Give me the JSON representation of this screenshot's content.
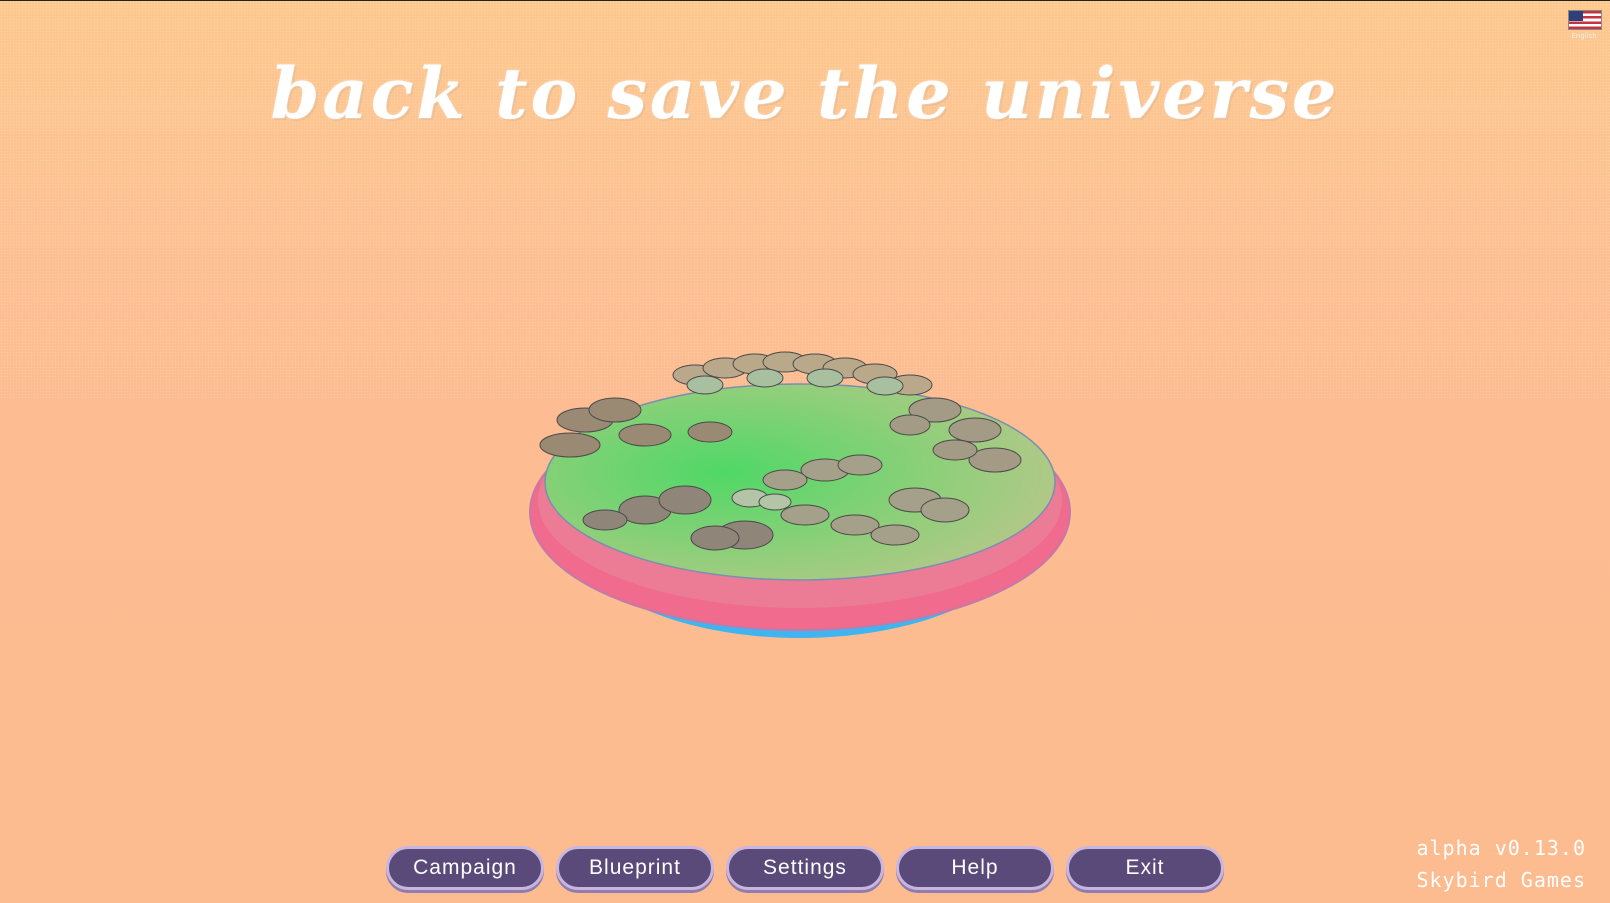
{
  "title": "back to save the universe",
  "language": {
    "icon": "us-flag-icon",
    "label": "English"
  },
  "menu": {
    "items": [
      {
        "label": "Campaign"
      },
      {
        "label": "Blueprint"
      },
      {
        "label": "Settings"
      },
      {
        "label": "Help"
      },
      {
        "label": "Exit"
      }
    ]
  },
  "footer": {
    "version": "alpha v0.13.0",
    "studio": "Skybird Games"
  },
  "colors": {
    "background": "#fdbc91",
    "button_fill": "#5a4a7a",
    "button_border": "#c8b6e0",
    "island_grass": "#5fd06a",
    "island_rim": "#f06b8e",
    "island_water": "#3fb4f0"
  }
}
